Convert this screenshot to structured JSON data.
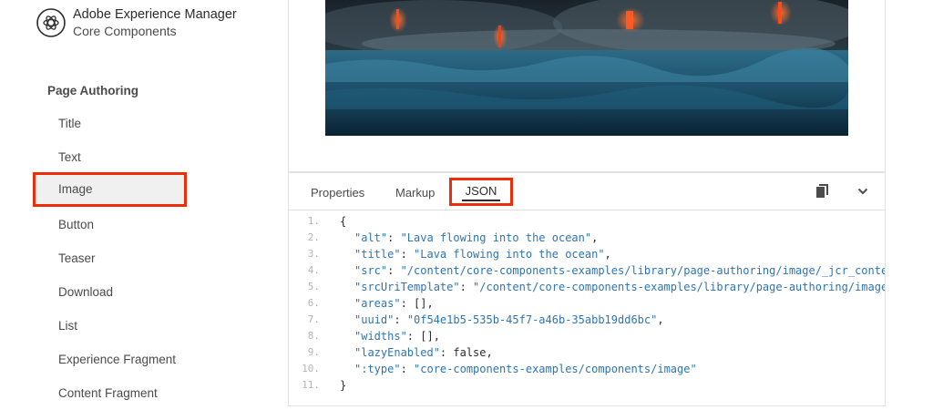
{
  "brand": {
    "title": "Adobe Experience Manager",
    "subtitle": "Core Components",
    "logo_icon": "adobe-aem-logo-icon"
  },
  "sidebar": {
    "section_heading": "Page Authoring",
    "items": [
      {
        "label": "Title",
        "active": false
      },
      {
        "label": "Text",
        "active": false
      },
      {
        "label": "Image",
        "active": true
      },
      {
        "label": "Button",
        "active": false
      },
      {
        "label": "Teaser",
        "active": false
      },
      {
        "label": "Download",
        "active": false
      },
      {
        "label": "List",
        "active": false
      },
      {
        "label": "Experience Fragment",
        "active": false
      },
      {
        "label": "Content Fragment",
        "active": false
      }
    ]
  },
  "preview": {
    "image_description_icon": "lava-ocean-image"
  },
  "code_panel": {
    "tabs": [
      {
        "label": "Properties",
        "active": false
      },
      {
        "label": "Markup",
        "active": false
      },
      {
        "label": "JSON",
        "active": true
      }
    ],
    "copy_icon": "copy-icon",
    "collapse_icon": "chevron-down-icon",
    "lines": [
      {
        "n": "1.",
        "key": "",
        "sep": "",
        "value": "",
        "raw": "{"
      },
      {
        "n": "2.",
        "key": "\"alt\"",
        "sep": ": ",
        "value": "\"Lava flowing into the ocean\"",
        "tail": ","
      },
      {
        "n": "3.",
        "key": "\"title\"",
        "sep": ": ",
        "value": "\"Lava flowing into the ocean\"",
        "tail": ","
      },
      {
        "n": "4.",
        "key": "\"src\"",
        "sep": ": ",
        "value": "\"/content/core-components-examples/library/page-authoring/image/_jcr_conte",
        "tail": ""
      },
      {
        "n": "5.",
        "key": "\"srcUriTemplate\"",
        "sep": ": ",
        "value": "\"/content/core-components-examples/library/page-authoring/image",
        "tail": ""
      },
      {
        "n": "6.",
        "key": "\"areas\"",
        "sep": ": ",
        "value": "[]",
        "tail": ","
      },
      {
        "n": "7.",
        "key": "\"uuid\"",
        "sep": ": ",
        "value": "\"0f54e1b5-535b-45f7-a46b-35abb19dd6bc\"",
        "tail": ","
      },
      {
        "n": "8.",
        "key": "\"widths\"",
        "sep": ": ",
        "value": "[]",
        "tail": ","
      },
      {
        "n": "9.",
        "key": "\"lazyEnabled\"",
        "sep": ": ",
        "value": "false",
        "tail": ","
      },
      {
        "n": "10.",
        "key": "\":type\"",
        "sep": ": ",
        "value": "\"core-components-examples/components/image\"",
        "tail": ""
      },
      {
        "n": "11.",
        "key": "",
        "sep": "",
        "value": "",
        "raw": "}"
      }
    ]
  },
  "colors": {
    "highlight": "#ee2d0b",
    "code_string": "#2e74b5",
    "text": "#4b4b4b"
  }
}
